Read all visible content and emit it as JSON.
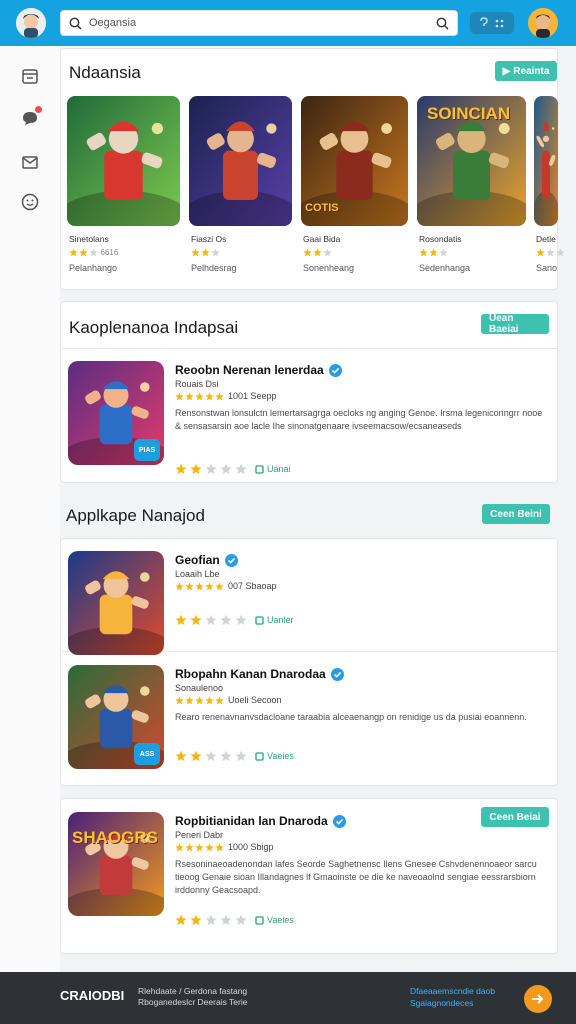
{
  "header": {
    "search_value": "Oegansia",
    "colors": {
      "bar": "#14a3e0",
      "toggle": "#1f86b8"
    }
  },
  "sidebar": {
    "items": [
      {
        "icon": "calendar-icon"
      },
      {
        "icon": "chat-icon",
        "badge": true
      },
      {
        "icon": "mail-icon"
      },
      {
        "icon": "face-icon"
      }
    ]
  },
  "featured": {
    "title": "Ndaansia",
    "button": "Reainta",
    "cards": [
      {
        "name": "Sinetolans",
        "meta": "6616",
        "stars": 2,
        "sub": "Pelanhango",
        "art": "game-art-1",
        "banner": ""
      },
      {
        "name": "Fiaszi Os",
        "meta": "",
        "stars": 2,
        "sub": "Pelhdesrag",
        "art": "game-art-2",
        "banner": ""
      },
      {
        "name": "Gaai Bida",
        "meta": "",
        "stars": 2,
        "sub": "Sonenheang",
        "art": "game-art-3",
        "banner": "COTIS"
      },
      {
        "name": "Rosondatis",
        "meta": "",
        "stars": 2,
        "sub": "Sedenhanga",
        "art": "game-art-4",
        "banner": "SOINCIAN"
      },
      {
        "name": "Detie",
        "meta": "",
        "stars": 1,
        "sub": "Sano",
        "art": "game-art-5",
        "banner": ""
      }
    ]
  },
  "section1": {
    "title": "Kaoplenanoa Indapsai",
    "button": "Uean Baeiai",
    "items": [
      {
        "title": "Reoobn Nerenan lenerdaa",
        "sub": "Rouais Dsi",
        "rating_text": "1001 Seepp",
        "desc": "Rensonstwan lonsulctn lemertarsagrga oecloks ng anging Genoe. Irsma legeniconngrr nooe & sensasarsin aoe lacle Ihe sinonatgenaare ivseemacsow/ecsaneaseds",
        "bottom_stars": 2,
        "link": "Uanai",
        "badge": "PIAS"
      }
    ]
  },
  "section2": {
    "title": "Applkape Nanajod",
    "button": "Ceen Beini",
    "items": [
      {
        "title": "Geofian",
        "sub": "Loaaih Lbe",
        "rating_text": "007 Sbaoap",
        "desc": "",
        "bottom_stars": 2,
        "link": "Uanler",
        "badge": ""
      },
      {
        "title": "Rbopahn Kanan Dnarodaa",
        "sub": "Sonaulenoo",
        "rating_text": "Uoeli Secoon",
        "desc": "Rearo renenavnanvsdacloane taraabia alceaenangp on renidige us da pusiai eoannenn.",
        "bottom_stars": 2,
        "link": "Vaeies",
        "badge": "ASS"
      }
    ]
  },
  "section3": {
    "button": "Ceen Beiai",
    "items": [
      {
        "title": "Ropbitianidan lan Dnaroda",
        "sub": "Peneri Dabr",
        "rating_text": "1000 Sbigp",
        "desc": "Rsesoninaeoadenondan lafes Seorde Saghetnensc Ilens Gnesee Cshvdenennoaeor sarcu tieoog Genaie sioan Illandagnes lf Gmaoinste oe die ke naveoaolnd sengiae eessrarsbiorn irddonny Geacsoapd.",
        "bottom_stars": 2,
        "link": "Vaeies",
        "banner": "SHAOGRS"
      }
    ]
  },
  "footer": {
    "brand": "CRAIODBI",
    "lines": [
      "Rlehdaate / Gerdona fastang",
      "Rboganedeslcr Deerais Terie"
    ],
    "links": [
      "Dfaeaaemscndie daob",
      "Sgaiagnondeces"
    ]
  }
}
